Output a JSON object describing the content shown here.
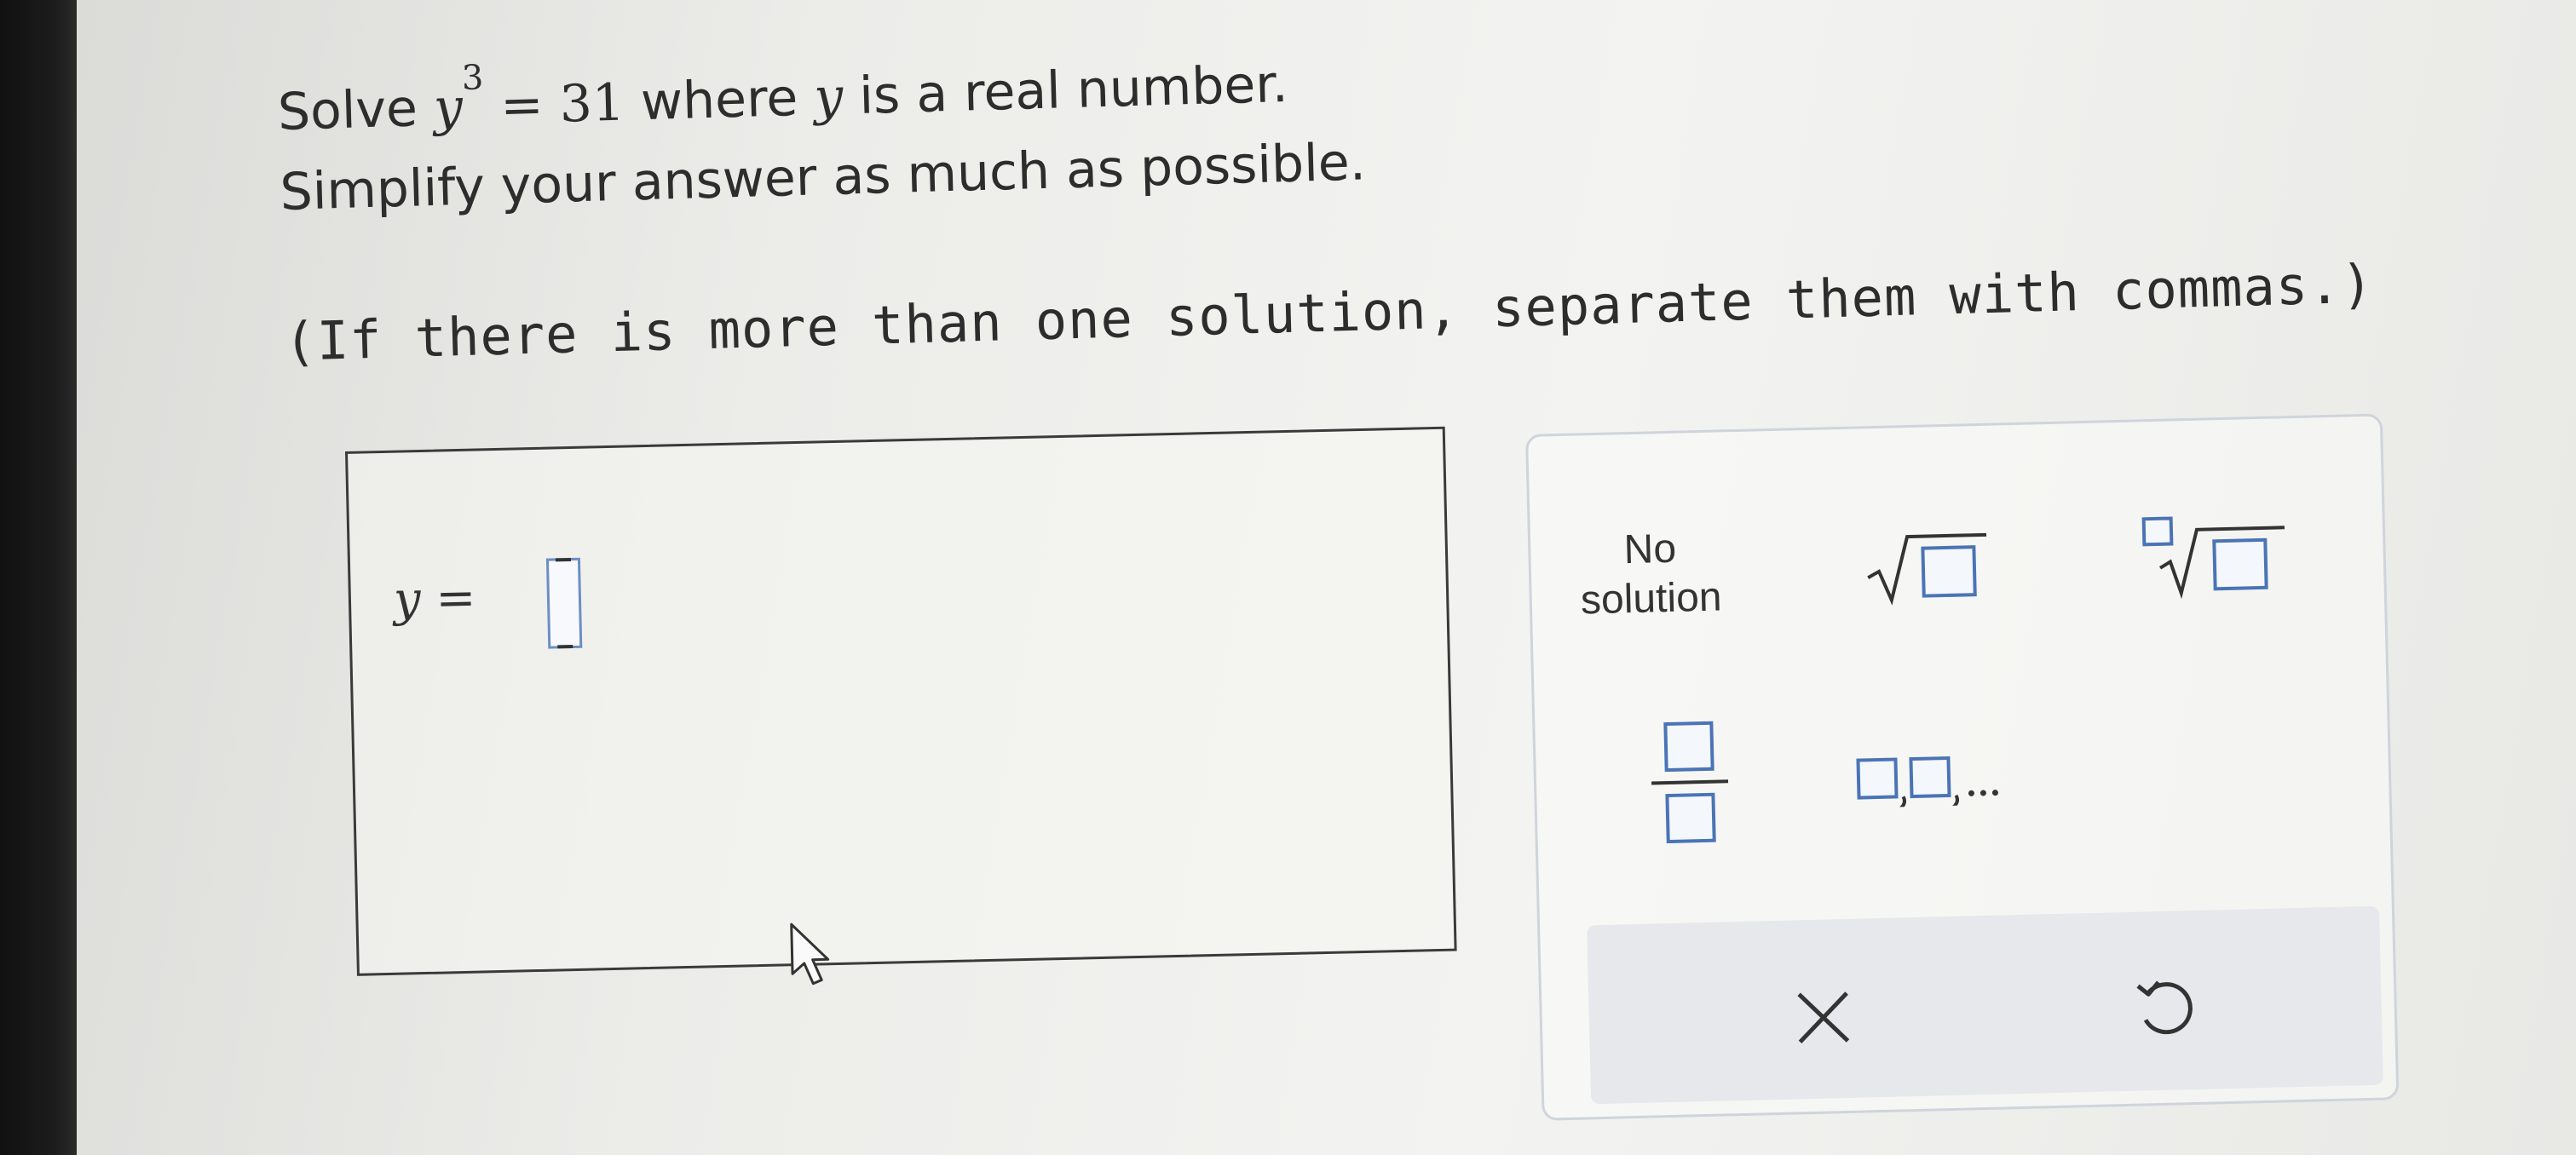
{
  "question": {
    "solve_word": "Solve",
    "variable": "y",
    "exponent": "3",
    "equals_value": "= 31",
    "where_text": "where",
    "variable2": "y",
    "rest_text": "is a real number.",
    "line2": "Simplify your answer as much as possible.",
    "line3": "(If there is more than one solution, separate them with commas.)"
  },
  "answer": {
    "variable": "y",
    "equals": "="
  },
  "keypad": {
    "no_solution_line1": "No",
    "no_solution_line2": "solution"
  },
  "colors": {
    "box_blue": "#6c8ec4",
    "icon_blue": "#4a74b5",
    "text": "#2d2d2d"
  }
}
